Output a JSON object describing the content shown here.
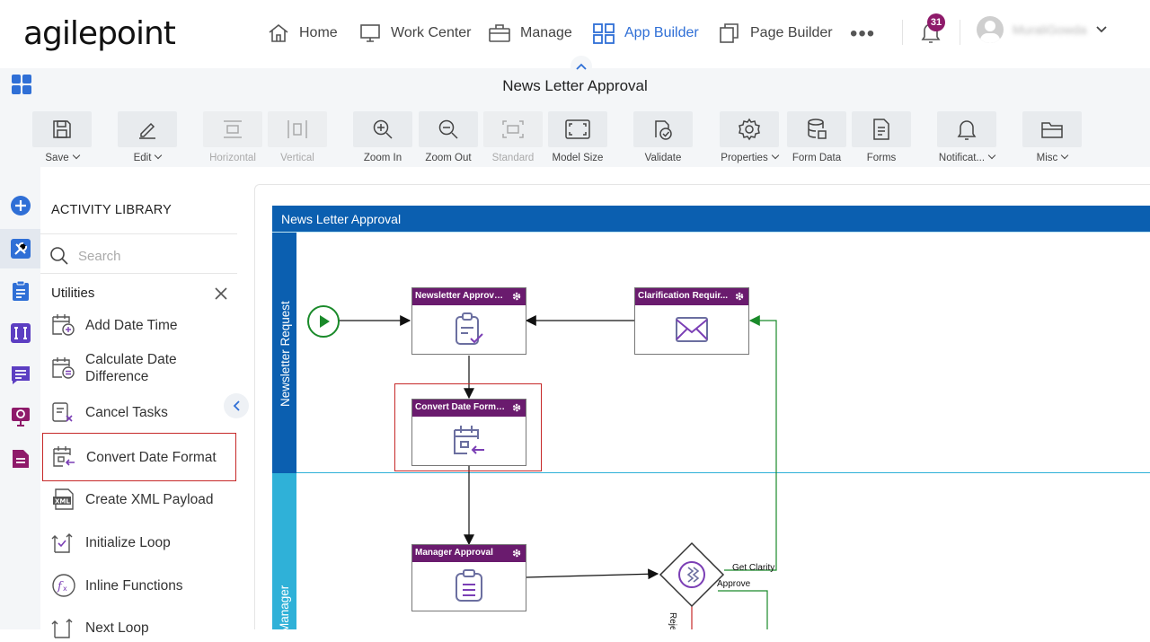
{
  "header": {
    "logo": "agilepoint",
    "nav": [
      {
        "label": "Home",
        "icon": "home-icon"
      },
      {
        "label": "Work Center",
        "icon": "monitor-icon"
      },
      {
        "label": "Manage",
        "icon": "briefcase-icon"
      },
      {
        "label": "App Builder",
        "icon": "grid-icon",
        "active": true
      },
      {
        "label": "Page Builder",
        "icon": "pages-icon"
      }
    ],
    "more": "•••",
    "notification_count": "31",
    "username": "MuraliGowda"
  },
  "titlebar": {
    "title": "News Letter Approval"
  },
  "toolbar": {
    "items": [
      {
        "label": "Save",
        "icon": "save-icon",
        "dropdown": true
      },
      {
        "label": "Edit",
        "icon": "pencil-icon",
        "dropdown": true
      },
      {
        "label": "Horizontal",
        "icon": "horizontal-icon",
        "disabled": true
      },
      {
        "label": "Vertical",
        "icon": "vertical-icon",
        "disabled": true
      },
      {
        "label": "Zoom In",
        "icon": "zoom-in-icon"
      },
      {
        "label": "Zoom Out",
        "icon": "zoom-out-icon"
      },
      {
        "label": "Standard",
        "icon": "standard-icon",
        "disabled": true
      },
      {
        "label": "Model Size",
        "icon": "model-size-icon"
      },
      {
        "label": "Validate",
        "icon": "validate-icon"
      },
      {
        "label": "Properties",
        "icon": "gear-icon",
        "dropdown": true
      },
      {
        "label": "Form Data",
        "icon": "database-icon"
      },
      {
        "label": "Forms",
        "icon": "forms-icon"
      },
      {
        "label": "Notificat...",
        "icon": "bell-icon",
        "dropdown": true
      },
      {
        "label": "Misc",
        "icon": "folder-icon",
        "dropdown": true
      }
    ]
  },
  "library": {
    "title": "ACTIVITY LIBRARY",
    "search_placeholder": "Search",
    "category": "Utilities",
    "items": [
      {
        "label": "Add Date Time",
        "icon": "add-date-time-icon"
      },
      {
        "label": "Calculate Date Difference",
        "icon": "calculate-date-difference-icon"
      },
      {
        "label": "Cancel Tasks",
        "icon": "cancel-tasks-icon"
      },
      {
        "label": "Convert Date Format",
        "icon": "convert-date-format-icon",
        "selected": true
      },
      {
        "label": "Create XML Payload",
        "icon": "xml-payload-icon"
      },
      {
        "label": "Initialize Loop",
        "icon": "initialize-loop-icon"
      },
      {
        "label": "Inline Functions",
        "icon": "inline-functions-icon"
      },
      {
        "label": "Next Loop",
        "icon": "next-loop-icon"
      }
    ]
  },
  "canvas": {
    "pool_title": "News Letter Approval",
    "lanes": [
      "Newsletter Request",
      "Manager"
    ],
    "tasks": [
      {
        "title": "Newsletter Approval ...",
        "icon": "clipboard-check-icon"
      },
      {
        "title": "Clarification Requir...",
        "icon": "envelope-icon"
      },
      {
        "title": "Convert Date Format.1",
        "icon": "calendar-convert-icon"
      },
      {
        "title": "Manager Approval",
        "icon": "clipboard-list-icon"
      }
    ],
    "edge_labels": {
      "get_clarity": "Get Clarity",
      "approve": "Approve",
      "reject": "Reject"
    }
  },
  "colors": {
    "brand_blue": "#0b5fb0",
    "lane_cyan": "#2fb1d8",
    "task_header": "#6a1b6e",
    "highlight": "#c62828",
    "accent": "#2f6fd6"
  }
}
